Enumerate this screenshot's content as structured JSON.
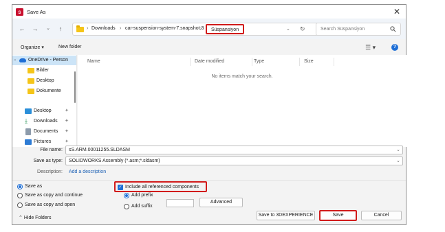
{
  "window": {
    "title": "Save As",
    "close_glyph": "✕"
  },
  "address": {
    "crumbs": [
      "Downloads",
      "car-suspension-system-7.snapshot.3"
    ],
    "current": "Süspansiyon",
    "search_placeholder": "Search Süspansiyon"
  },
  "commands": {
    "organize": "Organize ▾",
    "new_folder": "New folder"
  },
  "nav": {
    "items": [
      {
        "label": "OneDrive - Person",
        "icon": "cloud-icon",
        "selected": true
      },
      {
        "label": "Bilder",
        "icon": "folder-icon"
      },
      {
        "label": "Desktop",
        "icon": "folder-icon"
      },
      {
        "label": "Dokumente",
        "icon": "folder-icon"
      },
      {
        "label": "Desktop",
        "icon": "desktop-icon"
      },
      {
        "label": "Downloads",
        "icon": "download-icon"
      },
      {
        "label": "Documents",
        "icon": "documents-icon"
      },
      {
        "label": "Pictures",
        "icon": "pictures-icon"
      }
    ]
  },
  "file_list": {
    "columns": [
      "Name",
      "Date modified",
      "Type",
      "Size"
    ],
    "empty_message": "No items match your search."
  },
  "form": {
    "file_name_label": "File name:",
    "file_name_value": "sS.ARM.00011255.SLDASM",
    "save_as_type_label": "Save as type:",
    "save_as_type_value": "SOLIDWORKS Assembly (*.asm;*.sldasm)",
    "description_label": "Description:",
    "description_value": "Add a description"
  },
  "options": {
    "save_as": "Save as",
    "save_as_copy_continue": "Save as copy and continue",
    "save_as_copy_open": "Save as copy and open",
    "include_refs": "Include all referenced components",
    "add_prefix": "Add prefix",
    "add_suffix": "Add suffix",
    "advanced": "Advanced"
  },
  "footer": {
    "hide_folders": "Hide Folders",
    "save_3dx": "Save to 3DEXPERIENCE",
    "save": "Save",
    "cancel": "Cancel"
  },
  "colors": {
    "accent": "#1f6fd6",
    "highlight": "#d11a1a"
  }
}
